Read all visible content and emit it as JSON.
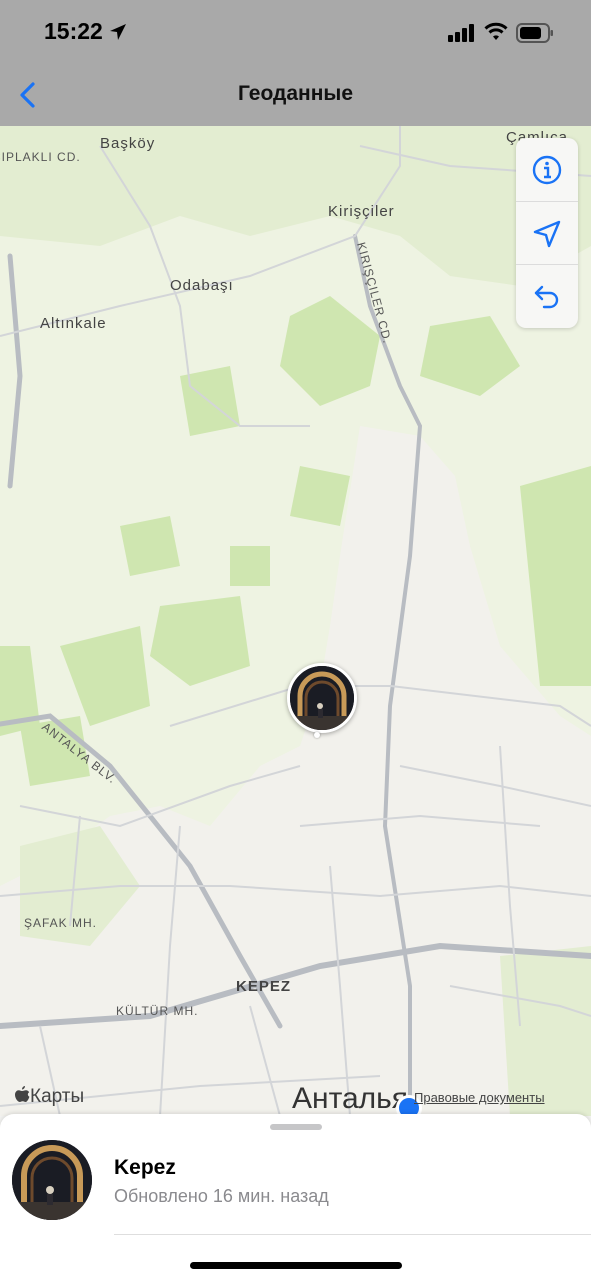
{
  "status_bar": {
    "time": "15:22"
  },
  "nav": {
    "title": "Геоданные",
    "back_icon": "chevron-left-icon"
  },
  "map": {
    "labels": {
      "baskoy": "Başköy",
      "kirisciler": "Kirişçiler",
      "odabasi": "Odabaşı",
      "altinkale": "Altınkale",
      "camlica": "Çamlıca",
      "kirisciler_cd": "KIRIŞÇILER CD.",
      "ciplakli_cd": "ÇIPLAKLI CD.",
      "antalya_blv": "ANTALYA BLV.",
      "safak_mh": "ŞAFAK MH.",
      "kultur_mh": "KÜLTÜR MH.",
      "kepez": "KEPEZ",
      "antalya": "Анталья"
    },
    "attribution": "Карты",
    "legal": "Правовые документы",
    "controls": [
      "info-icon",
      "location-arrow-icon",
      "undo-icon"
    ]
  },
  "sheet": {
    "place_name": "Kepez",
    "updated": "Обновлено 16 мин. назад"
  },
  "colors": {
    "accent": "#1a73f5",
    "park": "#cfe6b0",
    "urban": "#f2f1ec"
  }
}
